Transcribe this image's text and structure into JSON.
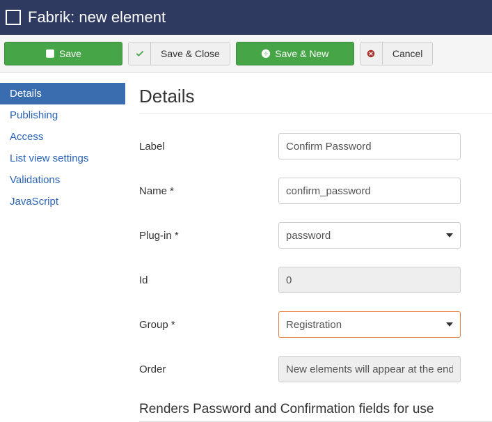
{
  "header": {
    "title": "Fabrik: new element"
  },
  "toolbar": {
    "save": "Save",
    "save_close": "Save & Close",
    "save_new": "Save & New",
    "cancel": "Cancel"
  },
  "sidebar": {
    "items": [
      {
        "label": "Details",
        "active": true
      },
      {
        "label": "Publishing",
        "active": false
      },
      {
        "label": "Access",
        "active": false
      },
      {
        "label": "List view settings",
        "active": false
      },
      {
        "label": "Validations",
        "active": false
      },
      {
        "label": "JavaScript",
        "active": false
      }
    ]
  },
  "content": {
    "section_title": "Details",
    "form": {
      "label_label": "Label",
      "label_value": "Confirm Password",
      "name_label": "Name *",
      "name_value": "confirm_password",
      "plugin_label": "Plug-in *",
      "plugin_value": "password",
      "id_label": "Id",
      "id_value": "0",
      "group_label": "Group *",
      "group_value": "Registration",
      "order_label": "Order",
      "order_value": "New elements will appear at the end"
    },
    "plugin_desc": "Renders Password and Confirmation fields for use"
  }
}
